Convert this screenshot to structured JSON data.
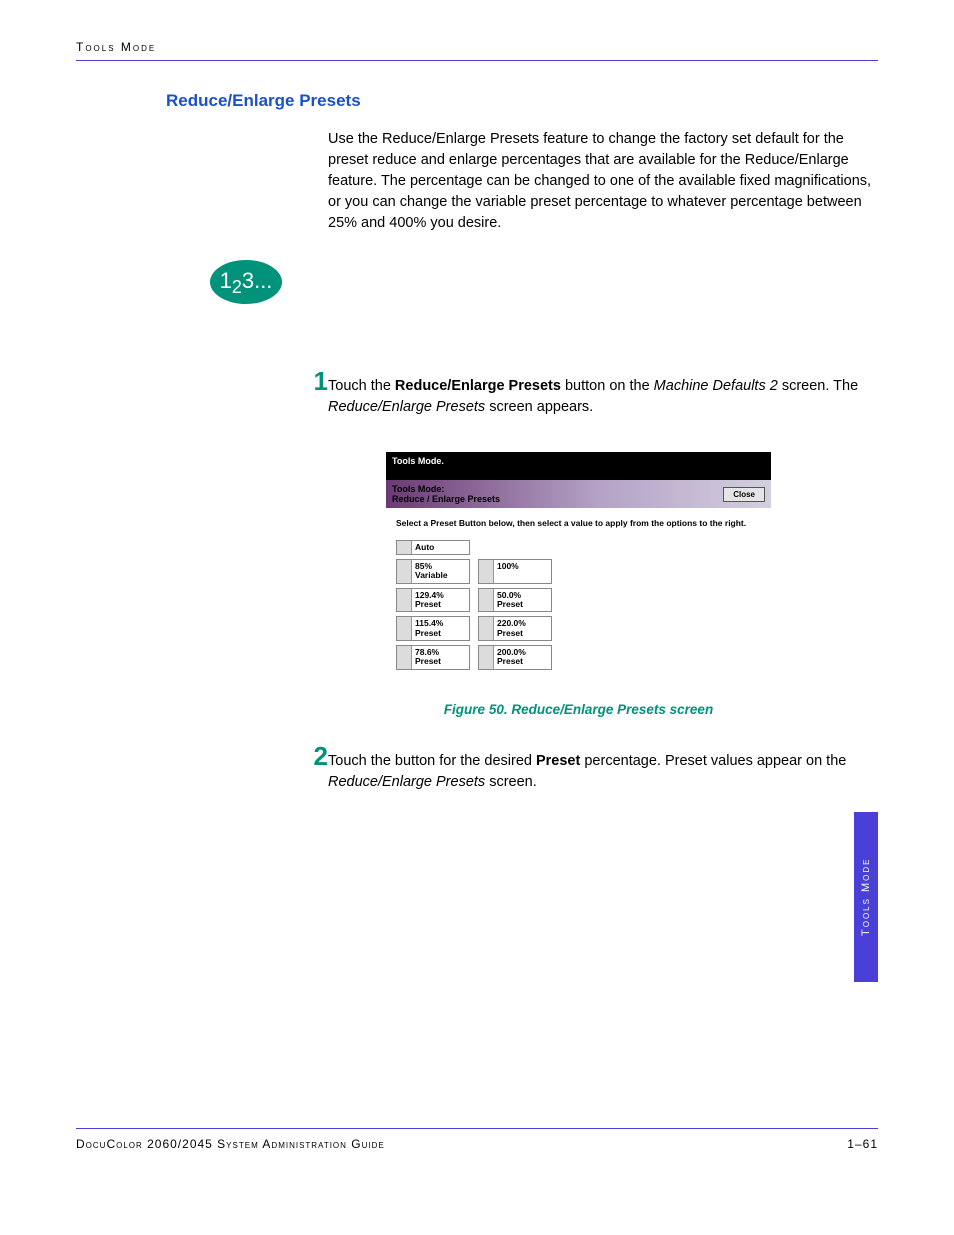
{
  "header": "Tools Mode",
  "section_title": "Reduce/Enlarge Presets",
  "intro_text": "Use the Reduce/Enlarge Presets feature to change the factory set default for the preset reduce and enlarge percentages that are available for the Reduce/Enlarge feature. The percentage can be changed to one of the available fixed magnifications, or you can change the variable preset percentage to whatever percentage between 25% and 400% you desire.",
  "step_badge_text": "1₂3...",
  "step1_num": "1",
  "step1_prefix": "Touch the ",
  "step1_bold": "Reduce/Enlarge Presets",
  "step1_mid": " button on the ",
  "step1_italic1": "Machine Defaults 2",
  "step1_mid2": " screen. The ",
  "step1_italic2": "Reduce/Enlarge Presets",
  "step1_suffix": " screen appears.",
  "screenshot": {
    "top_title": "Tools Mode.",
    "hdr_line1": "Tools Mode:",
    "hdr_line2": "Reduce / Enlarge Presets",
    "close": "Close",
    "instr": "Select a Preset Button below, then select a value to apply from the options to the right.",
    "auto": "Auto",
    "b_85": "85%",
    "b_var": "Variable",
    "b_100": "100%",
    "b_129": "129.4%",
    "b_preset": "Preset",
    "b_50": "50.0%",
    "b_115": "115.4%",
    "b_220": "220.0%",
    "b_78": "78.6%",
    "b_200": "200.0%"
  },
  "figure_caption": "Figure 50. Reduce/Enlarge Presets screen",
  "step2_num": "2",
  "step2_prefix": "Touch the button for the desired ",
  "step2_bold": "Preset",
  "step2_mid": " percentage. Preset values appear on the ",
  "step2_italic": "Reduce/Enlarge Presets",
  "step2_suffix": " screen.",
  "side_tab": "Tools Mode",
  "footer_left": "DocuColor 2060/2045 System Administration Guide",
  "footer_right": "1–61"
}
